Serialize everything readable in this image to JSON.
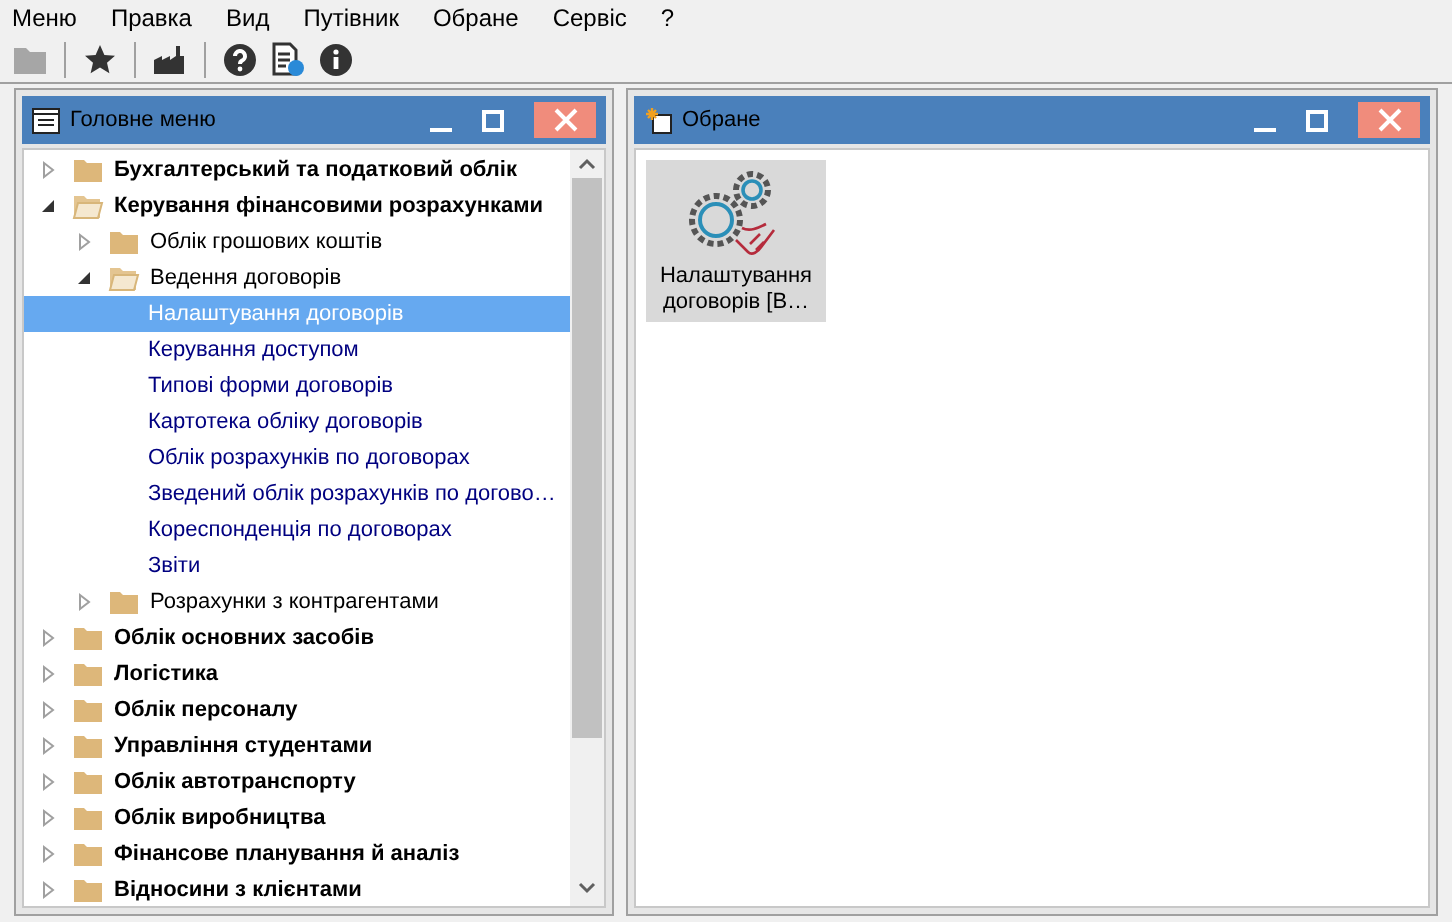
{
  "menu_bar": [
    {
      "label": "Меню"
    },
    {
      "label": "Правка"
    },
    {
      "label": "Вид"
    },
    {
      "label": "Путівник"
    },
    {
      "label": "Обране"
    },
    {
      "label": "Сервіс"
    },
    {
      "label": "?"
    }
  ],
  "toolbar": [
    {
      "kind": "folder",
      "disabled": true
    },
    {
      "kind": "star",
      "disabled": false
    },
    {
      "kind": "factory",
      "disabled": false
    },
    {
      "kind": "help",
      "disabled": false
    },
    {
      "kind": "doc-help",
      "disabled": false
    },
    {
      "kind": "info",
      "disabled": false
    }
  ],
  "main_menu_panel": {
    "title": "Головне меню",
    "tree": [
      {
        "label": "Бухгалтерський та податковий облік",
        "kind": "folder",
        "expanded": false,
        "selected": false
      },
      {
        "label": "Керування фінансовими розрахунками",
        "kind": "folder",
        "expanded": true,
        "selected": false,
        "children": [
          {
            "label": "Облік грошових коштів",
            "kind": "folder",
            "expanded": false,
            "selected": false
          },
          {
            "label": "Ведення договорів",
            "kind": "folder",
            "expanded": true,
            "selected": false,
            "children": [
              {
                "label": "Налаштування договорів",
                "kind": "leaf",
                "selected": true
              },
              {
                "label": "Керування доступом",
                "kind": "leaf",
                "selected": false
              },
              {
                "label": "Типові форми договорів",
                "kind": "leaf",
                "selected": false
              },
              {
                "label": "Картотека обліку договорів",
                "kind": "leaf",
                "selected": false
              },
              {
                "label": "Облік розрахунків по договорах",
                "kind": "leaf",
                "selected": false
              },
              {
                "label": "Зведений облік розрахунків по догово…",
                "kind": "leaf",
                "selected": false
              },
              {
                "label": "Кореспонденція по договорах",
                "kind": "leaf",
                "selected": false
              },
              {
                "label": "Звіти",
                "kind": "leaf",
                "selected": false
              }
            ]
          },
          {
            "label": "Розрахунки з контрагентами",
            "kind": "folder",
            "expanded": false,
            "selected": false
          }
        ]
      },
      {
        "label": "Облік основних засобів",
        "kind": "folder",
        "expanded": false,
        "selected": false
      },
      {
        "label": "Логістика",
        "kind": "folder",
        "expanded": false,
        "selected": false
      },
      {
        "label": "Облік персоналу",
        "kind": "folder",
        "expanded": false,
        "selected": false
      },
      {
        "label": "Управління студентами",
        "kind": "folder",
        "expanded": false,
        "selected": false
      },
      {
        "label": "Облік автотранспорту",
        "kind": "folder",
        "expanded": false,
        "selected": false
      },
      {
        "label": "Облік виробництва",
        "kind": "folder",
        "expanded": false,
        "selected": false
      },
      {
        "label": "Фінансове планування й аналіз",
        "kind": "folder",
        "expanded": false,
        "selected": false
      },
      {
        "label": "Відносини з клієнтами",
        "kind": "folder",
        "expanded": false,
        "selected": false
      }
    ]
  },
  "favorites_panel": {
    "title": "Обране",
    "items": [
      {
        "label": "Налаштування договорів [В…",
        "selected": true
      }
    ]
  }
}
